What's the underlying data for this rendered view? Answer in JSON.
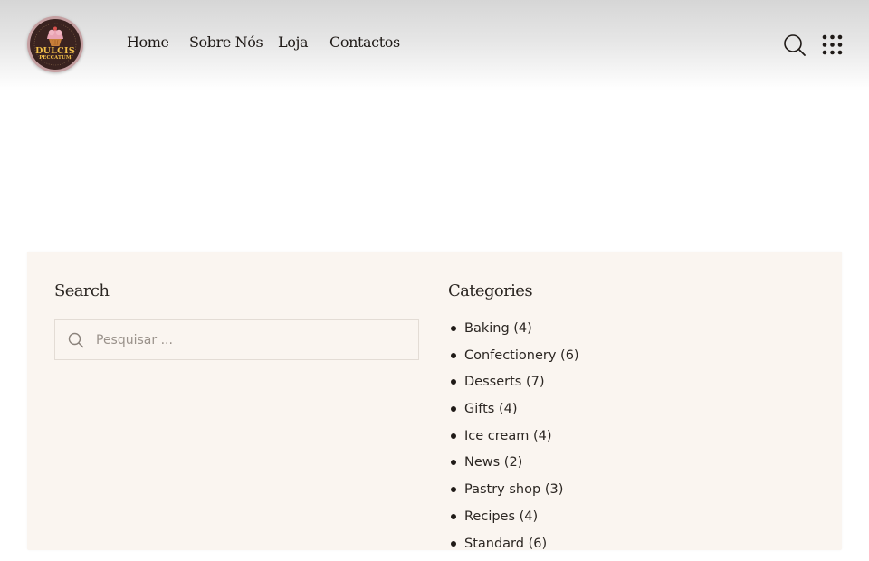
{
  "header": {
    "logo": {
      "line1": "DULCIS",
      "line2": "PECCATUM",
      "colors": {
        "ring": "#c5a0a2",
        "background": "#3a2320",
        "text": "#f2c04a",
        "cupcake": "#e9a3b3"
      }
    },
    "nav": [
      {
        "label": "Home"
      },
      {
        "label": "Sobre Nós"
      },
      {
        "label": "Loja"
      },
      {
        "label": "Contactos"
      }
    ],
    "icons": {
      "search": "search-icon",
      "menu": "grid-menu-icon"
    }
  },
  "widgets": {
    "background": "#faf5f0",
    "search": {
      "title": "Search",
      "placeholder": "Pesquisar ...",
      "value": ""
    },
    "categories": {
      "title": "Categories",
      "items": [
        {
          "name": "Baking",
          "count": "(4)"
        },
        {
          "name": "Confectionery",
          "count": "(6)"
        },
        {
          "name": "Desserts",
          "count": "(7)"
        },
        {
          "name": "Gifts",
          "count": "(4)"
        },
        {
          "name": "Ice cream",
          "count": "(4)"
        },
        {
          "name": "News",
          "count": "(2)"
        },
        {
          "name": "Pastry shop",
          "count": "(3)"
        },
        {
          "name": "Recipes",
          "count": "(4)"
        },
        {
          "name": "Standard",
          "count": "(6)"
        }
      ]
    }
  }
}
